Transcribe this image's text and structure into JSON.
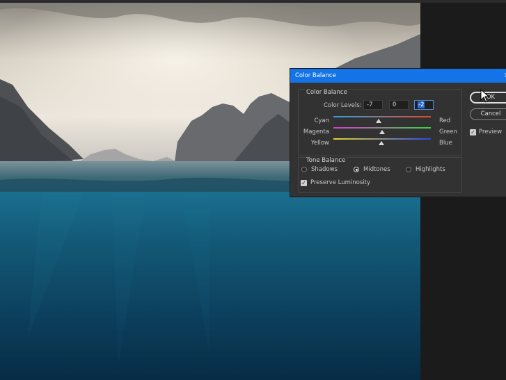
{
  "dialog": {
    "title": "Color Balance",
    "color_balance_group": "Color Balance",
    "color_levels_label": "Color Levels:",
    "levels": [
      "-7",
      "0",
      "-2"
    ],
    "sliders": [
      {
        "left": "Cyan",
        "right": "Red",
        "value": -7,
        "gradient": [
          "#2ea0e6",
          "#e64a2e"
        ]
      },
      {
        "left": "Magenta",
        "right": "Green",
        "value": 0,
        "gradient": [
          "#d63ad6",
          "#3ad63a"
        ]
      },
      {
        "left": "Yellow",
        "right": "Blue",
        "value": -2,
        "gradient": [
          "#e6d62e",
          "#2e4ae6"
        ]
      }
    ],
    "tone_balance_group": "Tone Balance",
    "tones": [
      {
        "label": "Shadows",
        "selected": false
      },
      {
        "label": "Midtones",
        "selected": true
      },
      {
        "label": "Highlights",
        "selected": false
      }
    ],
    "preserve_luminosity": {
      "label": "Preserve Luminosity",
      "checked": true
    },
    "ok_label": "OK",
    "cancel_label": "Cancel",
    "preview": {
      "label": "Preview",
      "checked": true
    },
    "close_glyph": "×",
    "check_glyph": "✓"
  },
  "colors": {
    "titlebar": "#1473e6",
    "dialog_bg": "#323232",
    "water": "#0d3e5a",
    "app_bg": "#1e1e1e"
  }
}
